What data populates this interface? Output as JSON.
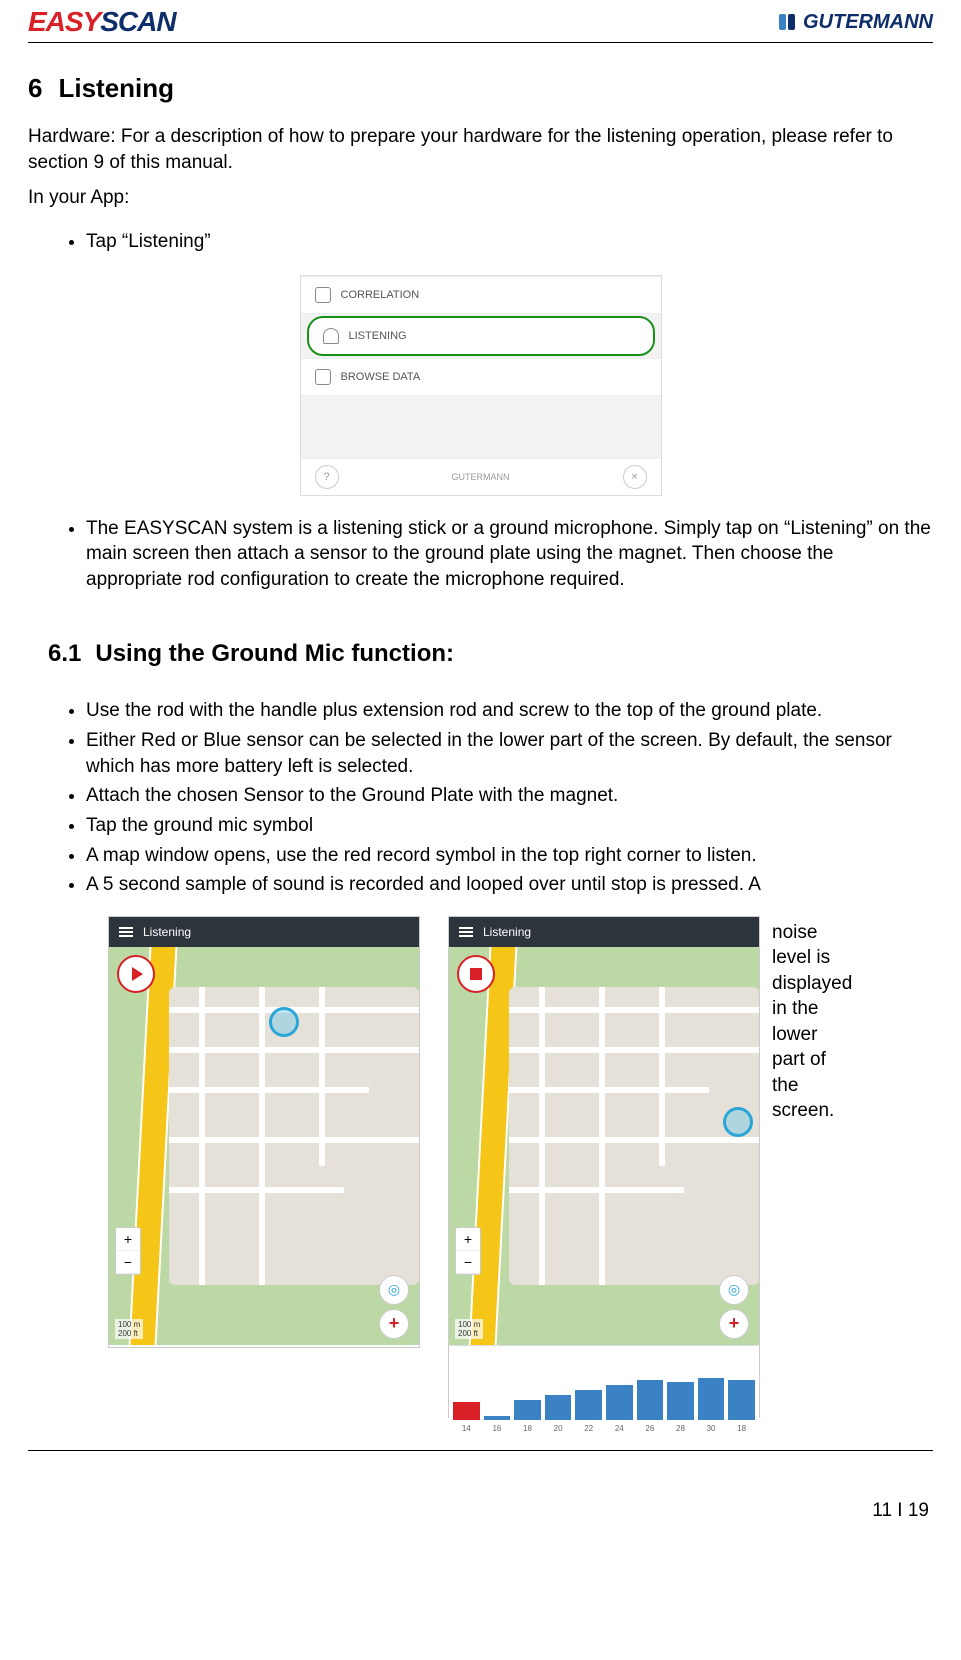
{
  "header": {
    "logo_left_part1": "EASY",
    "logo_left_part2": "SCAN",
    "logo_right": "GUTERMANN"
  },
  "section": {
    "number": "6",
    "title": "Listening",
    "intro": "Hardware: For a description of how to prepare your hardware for the listening operation, please refer to section 9 of this manual.",
    "in_your_app": "In your App:",
    "bullet_tap": "Tap “Listening”",
    "bullet_system": "The EASYSCAN system is a listening stick or a ground microphone. Simply tap on “Listening” on the main screen then attach a sensor to the ground plate using the magnet. Then choose the appropriate rod configuration to create the microphone required."
  },
  "menu_screenshot": {
    "row1": "CORRELATION",
    "row2": "LISTENING",
    "row3": "BROWSE DATA",
    "footer_brand": "GUTERMANN",
    "footer_left": "?",
    "footer_right": "×"
  },
  "subsection": {
    "number": "6.1",
    "title": "Using the Ground Mic function:",
    "bullets": [
      "Use the rod with the handle plus extension rod and screw to the top of the ground plate.",
      "Either Red or Blue sensor can be selected in the lower part of the screen. By default, the sensor which has more battery left is selected.",
      "Attach the chosen Sensor to the Ground Plate with the magnet.",
      "Tap the ground mic symbol",
      "A map window opens, use the red record symbol in the top right corner to listen.",
      "A 5 second sample of sound is recorded and looped over until stop is pressed. A"
    ],
    "side_text": "noise level is displayed in the lower part of the screen."
  },
  "map": {
    "title": "Listening",
    "zoom_plus": "+",
    "zoom_minus": "−",
    "add": "+",
    "locate": "◎",
    "scale_left": "100 m\n200 ft",
    "scale_right": "100 m\n200 ft"
  },
  "noise": {
    "labels": [
      "14",
      "16",
      "18",
      "20",
      "22",
      "24",
      "26",
      "28",
      "30",
      "18"
    ],
    "heights": [
      18,
      4,
      20,
      25,
      30,
      35,
      40,
      38,
      42,
      40
    ]
  },
  "footer": {
    "page": "11 I 19"
  }
}
